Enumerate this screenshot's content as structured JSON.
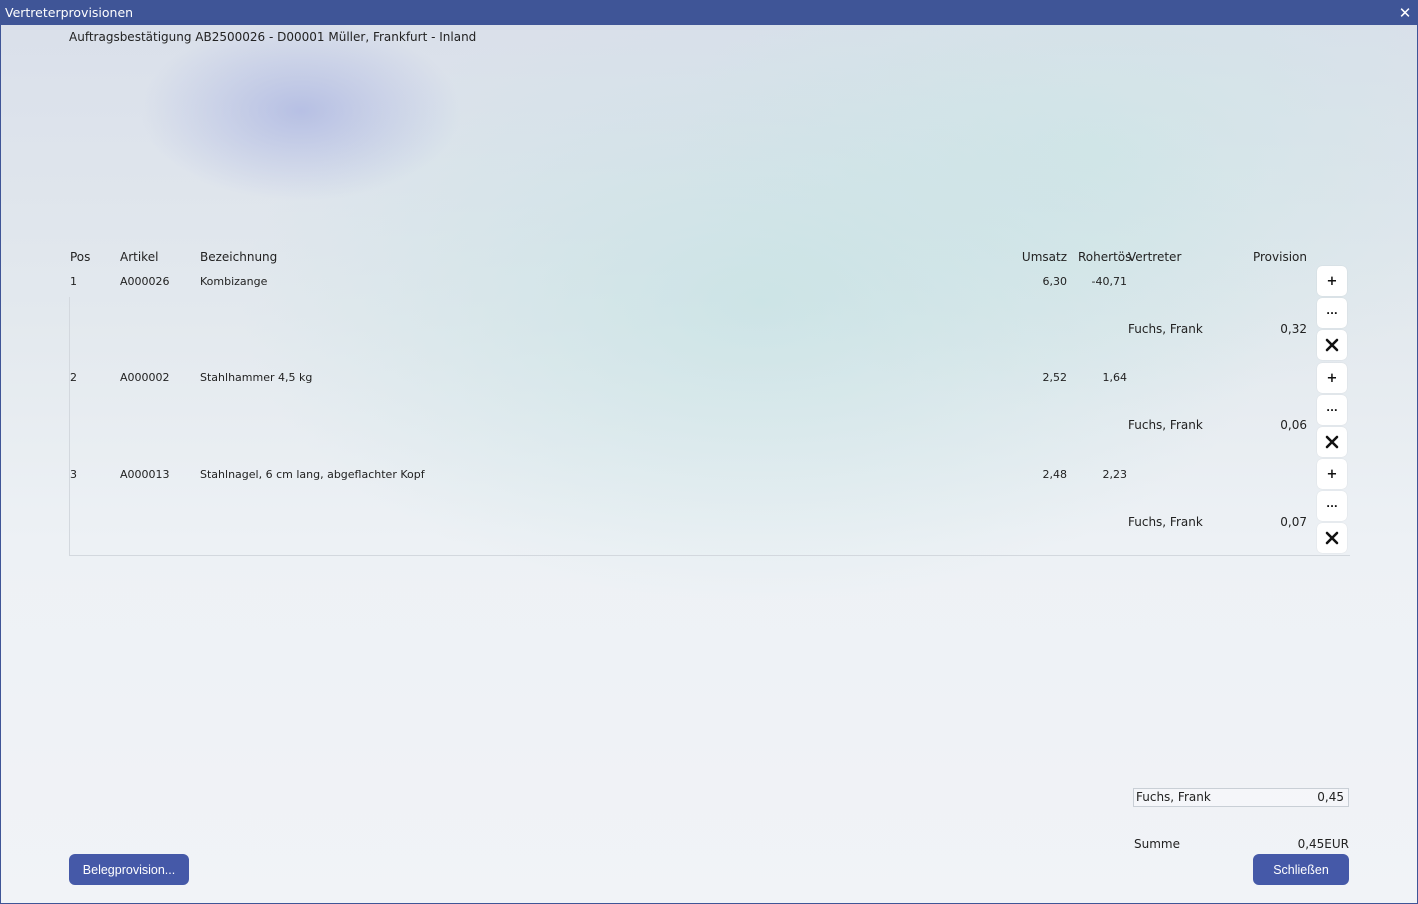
{
  "window": {
    "title": "Vertreterprovisionen",
    "close_glyph": "✕",
    "subtitle": "Auftragsbestätigung AB2500026 - D00001 Müller, Frankfurt - Inland"
  },
  "table": {
    "columns": {
      "pos": "Pos",
      "artikel": "Artikel",
      "bezeichnung": "Bezeichnung",
      "umsatz": "Umsatz",
      "roherloes": "Rohertös",
      "vertreter": "Vertreter",
      "provision": "Provision"
    },
    "rows": [
      {
        "pos": "1",
        "artikel": "A000026",
        "bezeichnung": "Kombizange",
        "umsatz": "6,30",
        "roherloes": "-40,71",
        "vertreter": "Fuchs, Frank",
        "provision": "0,32"
      },
      {
        "pos": "2",
        "artikel": "A000002",
        "bezeichnung": "Stahlhammer 4,5 kg",
        "umsatz": "2,52",
        "roherloes": "1,64",
        "vertreter": "Fuchs, Frank",
        "provision": "0,06"
      },
      {
        "pos": "3",
        "artikel": "A000013",
        "bezeichnung": "Stahlnagel, 6 cm lang, abgeflachter Kopf",
        "umsatz": "2,48",
        "roherloes": "2,23",
        "vertreter": "Fuchs, Frank",
        "provision": "0,07"
      }
    ],
    "row_buttons": {
      "add": "+",
      "more": "..."
    }
  },
  "summary": {
    "vertreter": "Fuchs, Frank",
    "provision": "0,45",
    "sum_label": "Summe",
    "sum_value": "0,45EUR"
  },
  "buttons": {
    "belegprovision": "Belegprovision...",
    "schliessen": "Schließen"
  },
  "colors": {
    "titlebar": "#3f5597",
    "button": "#4559a8"
  },
  "icons": {
    "close": "close-icon",
    "add": "plus-icon",
    "more": "ellipsis-icon",
    "delete": "delete-x-icon"
  }
}
